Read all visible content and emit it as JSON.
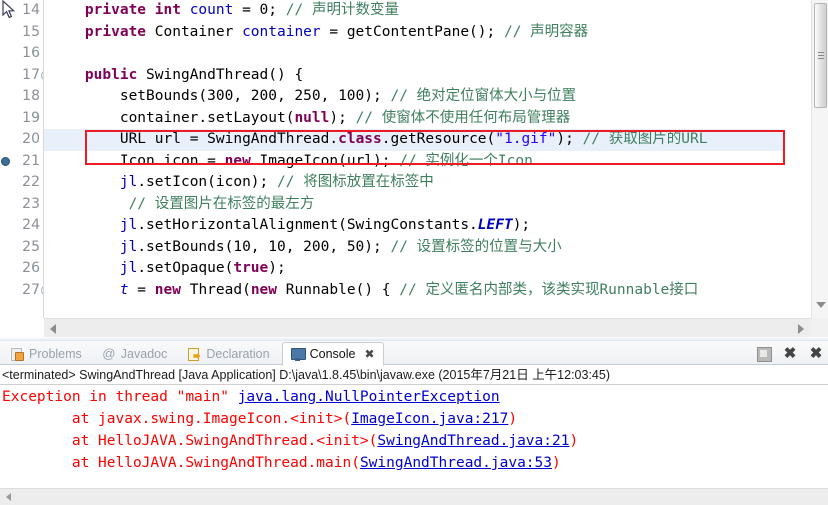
{
  "editor": {
    "lines": [
      {
        "num": "14",
        "fold": false,
        "bp": false,
        "hl": false,
        "tokens": [
          {
            "t": "    ",
            "c": "plain"
          },
          {
            "t": "private",
            "c": "kw"
          },
          {
            "t": " ",
            "c": "plain"
          },
          {
            "t": "int",
            "c": "kw"
          },
          {
            "t": " ",
            "c": "plain"
          },
          {
            "t": "count",
            "c": "fld"
          },
          {
            "t": " = 0; ",
            "c": "plain"
          },
          {
            "t": "// 声明计数变量",
            "c": "cm"
          }
        ]
      },
      {
        "num": "15",
        "fold": false,
        "bp": false,
        "hl": false,
        "tokens": [
          {
            "t": "    ",
            "c": "plain"
          },
          {
            "t": "private",
            "c": "kw"
          },
          {
            "t": " Container ",
            "c": "plain"
          },
          {
            "t": "container",
            "c": "fld"
          },
          {
            "t": " = getContentPane(); ",
            "c": "plain"
          },
          {
            "t": "// 声明容器",
            "c": "cm"
          }
        ]
      },
      {
        "num": "16",
        "fold": false,
        "bp": false,
        "hl": false,
        "tokens": [
          {
            "t": "",
            "c": "plain"
          }
        ]
      },
      {
        "num": "17",
        "fold": true,
        "bp": false,
        "hl": false,
        "tokens": [
          {
            "t": "    ",
            "c": "plain"
          },
          {
            "t": "public",
            "c": "kw"
          },
          {
            "t": " SwingAndThread() {",
            "c": "plain"
          }
        ]
      },
      {
        "num": "18",
        "fold": false,
        "bp": false,
        "hl": false,
        "tokens": [
          {
            "t": "        setBounds(300, 200, 250, 100); ",
            "c": "plain"
          },
          {
            "t": "// 绝对定位窗体大小与位置",
            "c": "cm"
          }
        ]
      },
      {
        "num": "19",
        "fold": false,
        "bp": false,
        "hl": false,
        "tokens": [
          {
            "t": "        container",
            "c": "plain"
          },
          {
            "t": ".setLayout(",
            "c": "plain"
          },
          {
            "t": "null",
            "c": "kw"
          },
          {
            "t": "); ",
            "c": "plain"
          },
          {
            "t": "// 使窗体不使用任何布局管理器",
            "c": "cm"
          }
        ]
      },
      {
        "num": "20",
        "fold": false,
        "bp": false,
        "hl": true,
        "tokens": [
          {
            "t": "        URL ",
            "c": "plain"
          },
          {
            "t": "url",
            "c": "plain"
          },
          {
            "t": " = SwingAndThread.",
            "c": "plain"
          },
          {
            "t": "class",
            "c": "kw"
          },
          {
            "t": ".getResource(",
            "c": "plain"
          },
          {
            "t": "\"1.gif\"",
            "c": "str"
          },
          {
            "t": "); ",
            "c": "plain"
          },
          {
            "t": "// 获取图片的URL",
            "c": "cm"
          }
        ]
      },
      {
        "num": "21",
        "fold": false,
        "bp": true,
        "hl": false,
        "tokens": [
          {
            "t": "        Icon ",
            "c": "plain"
          },
          {
            "t": "icon",
            "c": "plain"
          },
          {
            "t": " = ",
            "c": "plain"
          },
          {
            "t": "new",
            "c": "kw"
          },
          {
            "t": " ImageIcon(url); ",
            "c": "plain"
          },
          {
            "t": "// 实例化一个Icon",
            "c": "cm"
          }
        ]
      },
      {
        "num": "22",
        "fold": false,
        "bp": false,
        "hl": false,
        "tokens": [
          {
            "t": "        ",
            "c": "plain"
          },
          {
            "t": "jl",
            "c": "fld"
          },
          {
            "t": ".setIcon(icon); ",
            "c": "plain"
          },
          {
            "t": "// 将图标放置在标签中",
            "c": "cm"
          }
        ]
      },
      {
        "num": "23",
        "fold": false,
        "bp": false,
        "hl": false,
        "tokens": [
          {
            "t": "         ",
            "c": "plain"
          },
          {
            "t": "// 设置图片在标签的最左方",
            "c": "cm"
          }
        ]
      },
      {
        "num": "24",
        "fold": false,
        "bp": false,
        "hl": false,
        "tokens": [
          {
            "t": "        ",
            "c": "plain"
          },
          {
            "t": "jl",
            "c": "fld"
          },
          {
            "t": ".setHorizontalAlignment(SwingConstants.",
            "c": "plain"
          },
          {
            "t": "LEFT",
            "c": "stat"
          },
          {
            "t": ");",
            "c": "plain"
          }
        ]
      },
      {
        "num": "25",
        "fold": false,
        "bp": false,
        "hl": false,
        "tokens": [
          {
            "t": "        ",
            "c": "plain"
          },
          {
            "t": "jl",
            "c": "fld"
          },
          {
            "t": ".setBounds(10, 10, 200, 50); ",
            "c": "plain"
          },
          {
            "t": "// 设置标签的位置与大小",
            "c": "cm"
          }
        ]
      },
      {
        "num": "26",
        "fold": false,
        "bp": false,
        "hl": false,
        "tokens": [
          {
            "t": "        ",
            "c": "plain"
          },
          {
            "t": "jl",
            "c": "fld"
          },
          {
            "t": ".setOpaque(",
            "c": "plain"
          },
          {
            "t": "true",
            "c": "kw"
          },
          {
            "t": ");",
            "c": "plain"
          }
        ]
      },
      {
        "num": "27",
        "fold": true,
        "bp": false,
        "hl": false,
        "tokens": [
          {
            "t": "        ",
            "c": "plain"
          },
          {
            "t": "t",
            "c": "fldi"
          },
          {
            "t": " = ",
            "c": "plain"
          },
          {
            "t": "new",
            "c": "kw"
          },
          {
            "t": " Thread(",
            "c": "plain"
          },
          {
            "t": "new",
            "c": "kw"
          },
          {
            "t": " Runnable() { ",
            "c": "plain"
          },
          {
            "t": "// 定义匿名内部类，该类实现Runnable接口",
            "c": "cm"
          }
        ]
      }
    ]
  },
  "panel": {
    "tabs": [
      {
        "label": "Problems",
        "icon": "problems-icon",
        "active": false
      },
      {
        "label": "Javadoc",
        "icon": "javadoc-icon",
        "active": false
      },
      {
        "label": "Declaration",
        "icon": "declaration-icon",
        "active": false
      },
      {
        "label": "Console",
        "icon": "console-icon",
        "active": true,
        "close": "✖"
      }
    ],
    "tools": [
      {
        "name": "terminate-button",
        "glyph": ""
      },
      {
        "name": "remove-launch-button",
        "glyph": "✖"
      },
      {
        "name": "remove-all-terminated-button",
        "glyph": "✖"
      }
    ],
    "process_line": "<terminated> SwingAndThread [Java Application] D:\\java\\1.8.45\\bin\\javaw.exe (2015年7月21日 上午12:03:45)",
    "output": [
      {
        "parts": [
          {
            "t": "Exception in thread \"main\" ",
            "c": "err"
          },
          {
            "t": "java.lang.NullPointerException",
            "c": "lnk"
          }
        ]
      },
      {
        "parts": [
          {
            "t": "\tat javax.swing.ImageIcon.<init>(",
            "c": "err"
          },
          {
            "t": "ImageIcon.java:217",
            "c": "lnk"
          },
          {
            "t": ")",
            "c": "err"
          }
        ]
      },
      {
        "parts": [
          {
            "t": "\tat HelloJAVA.SwingAndThread.<init>(",
            "c": "err"
          },
          {
            "t": "SwingAndThread.java:21",
            "c": "lnk"
          },
          {
            "t": ")",
            "c": "err"
          }
        ]
      },
      {
        "parts": [
          {
            "t": "\tat HelloJAVA.SwingAndThread.main(",
            "c": "err"
          },
          {
            "t": "SwingAndThread.java:53",
            "c": "lnk"
          },
          {
            "t": ")",
            "c": "err"
          }
        ]
      }
    ]
  },
  "colors": {
    "keyword": "#7f0055",
    "comment": "#3f7f5f",
    "string": "#2a00ff",
    "field": "#0000c0",
    "error": "#ff0000",
    "link": "#0000d0",
    "highlight_box": "#ed1c24",
    "selected_line": "#e8f0fb"
  }
}
